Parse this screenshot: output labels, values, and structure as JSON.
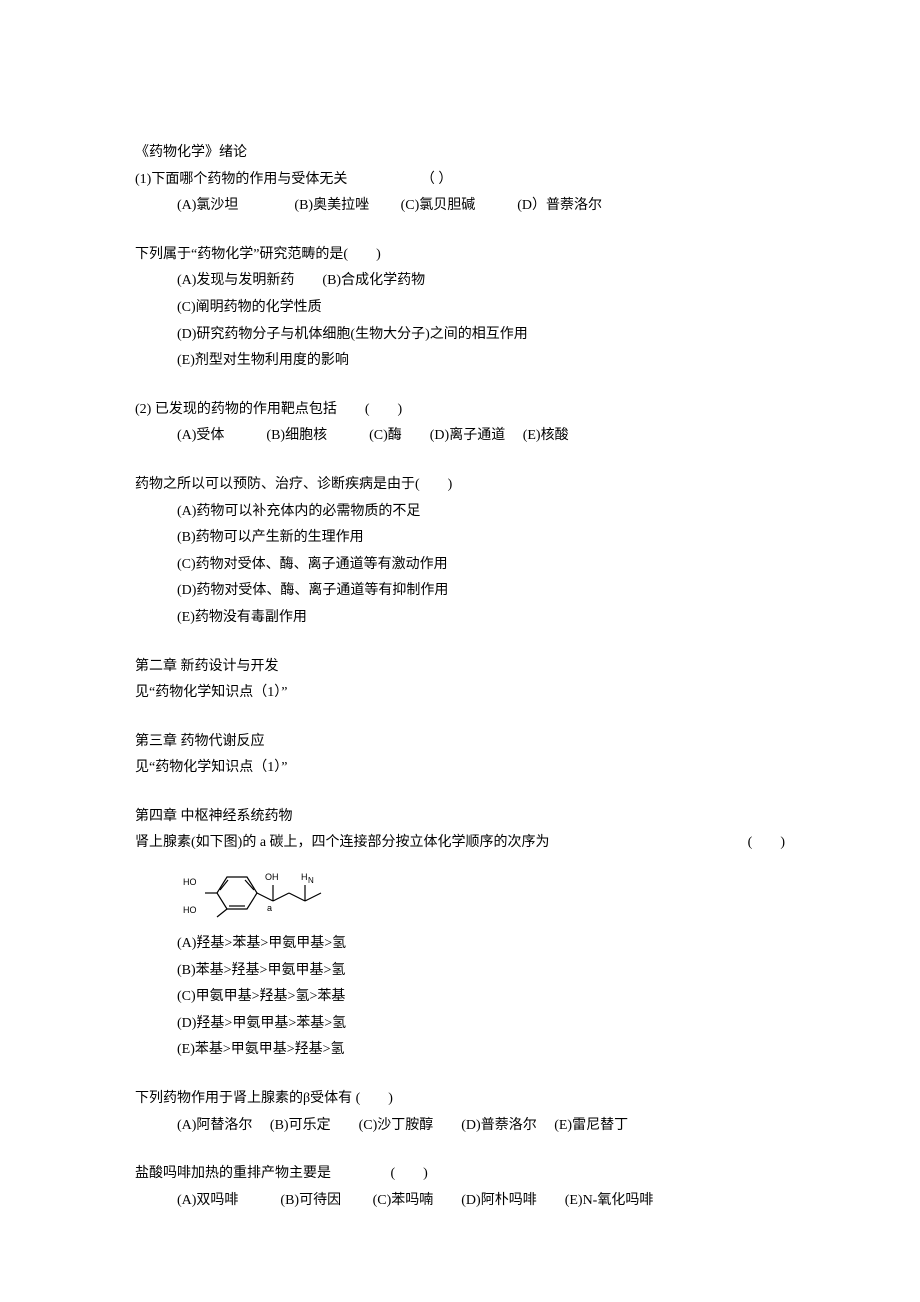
{
  "intro": {
    "title": "《药物化学》绪论",
    "q1": {
      "stem": "(1)下面哪个药物的作用与受体无关",
      "blank": "（  ）",
      "opts": "(A)氯沙坦　　　　(B)奥美拉唑　　 (C)氯贝胆碱　　　(D）普萘洛尔"
    },
    "q2": {
      "stem": "下列属于“药物化学”研究范畴的是(　　)",
      "a": "(A)发现与发明新药　　(B)合成化学药物",
      "c": "(C)阐明药物的化学性质",
      "d": "(D)研究药物分子与机体细胞(生物大分子)之间的相互作用",
      "e": "(E)剂型对生物利用度的影响"
    },
    "q3": {
      "stem": "(2) 已发现的药物的作用靶点包括　　(　　)",
      "opts": "(A)受体　　　(B)细胞核　　　(C)酶　　(D)离子通道　 (E)核酸"
    },
    "q4": {
      "stem": "药物之所以可以预防、治疗、诊断疾病是由于(　　)",
      "a": "(A)药物可以补充体内的必需物质的不足",
      "b": "(B)药物可以产生新的生理作用",
      "c": "(C)药物对受体、酶、离子通道等有激动作用",
      "d": "(D)药物对受体、酶、离子通道等有抑制作用",
      "e": "(E)药物没有毒副作用"
    }
  },
  "ch2": {
    "title": "第二章 新药设计与开发",
    "line": "见“药物化学知识点（1）”"
  },
  "ch3": {
    "title": "第三章 药物代谢反应",
    "line": "见“药物化学知识点（1）”"
  },
  "ch4": {
    "title": "第四章 中枢神经系统药物",
    "q1": {
      "stem": "肾上腺素(如下图)的 a 碳上，四个连接部分按立体化学顺序的次序为",
      "blank": "(　　)",
      "a": "(A)羟基>苯基>甲氨甲基>氢",
      "b": "(B)苯基>羟基>甲氨甲基>氢",
      "c": "(C)甲氨甲基>羟基>氢>苯基",
      "d": "(D)羟基>甲氨甲基>苯基>氢",
      "e": "(E)苯基>甲氨甲基>羟基>氢"
    },
    "q2": {
      "stem": "下列药物作用于肾上腺素的β受体有 (　　)",
      "opts": "(A)阿替洛尔　 (B)可乐定　　(C)沙丁胺醇　　(D)普萘洛尔　 (E)雷尼替丁"
    },
    "q3": {
      "stem": "盐酸吗啡加热的重排产物主要是　　　　 (　　)",
      "opts": "(A)双吗啡　　　(B)可待因　　 (C)苯吗喃　　(D)阿朴吗啡　　(E)N-氧化吗啡"
    }
  },
  "chem_labels": {
    "ho1": "HO",
    "ho2": "HO",
    "oh": "OH",
    "h": "H",
    "n": "N",
    "a": "a"
  }
}
